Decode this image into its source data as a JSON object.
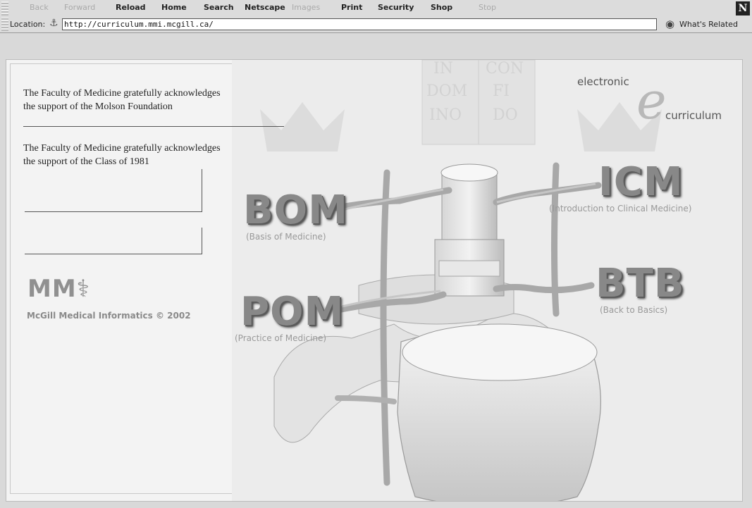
{
  "toolbar": {
    "buttons": [
      {
        "label": "Back",
        "enabled": false
      },
      {
        "label": "Forward",
        "enabled": false
      },
      {
        "label": "Reload",
        "enabled": true
      },
      {
        "label": "Home",
        "enabled": true
      },
      {
        "label": "Search",
        "enabled": true
      },
      {
        "label": "Netscape",
        "enabled": true
      },
      {
        "label": "Images",
        "enabled": false
      },
      {
        "label": "Print",
        "enabled": true
      },
      {
        "label": "Security",
        "enabled": true
      },
      {
        "label": "Shop",
        "enabled": true
      },
      {
        "label": "Stop",
        "enabled": false
      }
    ],
    "logo_letter": "N"
  },
  "location": {
    "label": "Location:",
    "url": "http://curriculum.mmi.mcgill.ca/",
    "related_label": "What's Related"
  },
  "page": {
    "ack_molson_line1": "The Faculty of Medicine gratefully acknowledges",
    "ack_molson_line2": "the support of the Molson Foundation",
    "ack_class_line1": "The Faculty of Medicine gratefully acknowledges",
    "ack_class_line2": "the support of the Class of 1981",
    "crest_text": [
      "IN",
      "CON",
      "DOM",
      "FI",
      "INO",
      "DO"
    ],
    "mm_logo": "MM⚕",
    "mm_credit": "McGill Medical Informatics © 2002",
    "ec_top": "electronic",
    "ec_letter": "e",
    "ec_bottom": "curriculum",
    "links": {
      "bom": {
        "title": "BOM",
        "subtitle": "(Basis of Medicine)"
      },
      "icm": {
        "title": "ICM",
        "subtitle": "(Introduction to Clinical Medicine)"
      },
      "pom": {
        "title": "POM",
        "subtitle": "(Practice of Medicine)"
      },
      "btb": {
        "title": "BTB",
        "subtitle": "(Back to Basics)"
      }
    }
  },
  "colors": {
    "toolbar_bg": "#dcdcdc",
    "page_bg": "#f3f3f3",
    "heading_gray": "#888888"
  }
}
